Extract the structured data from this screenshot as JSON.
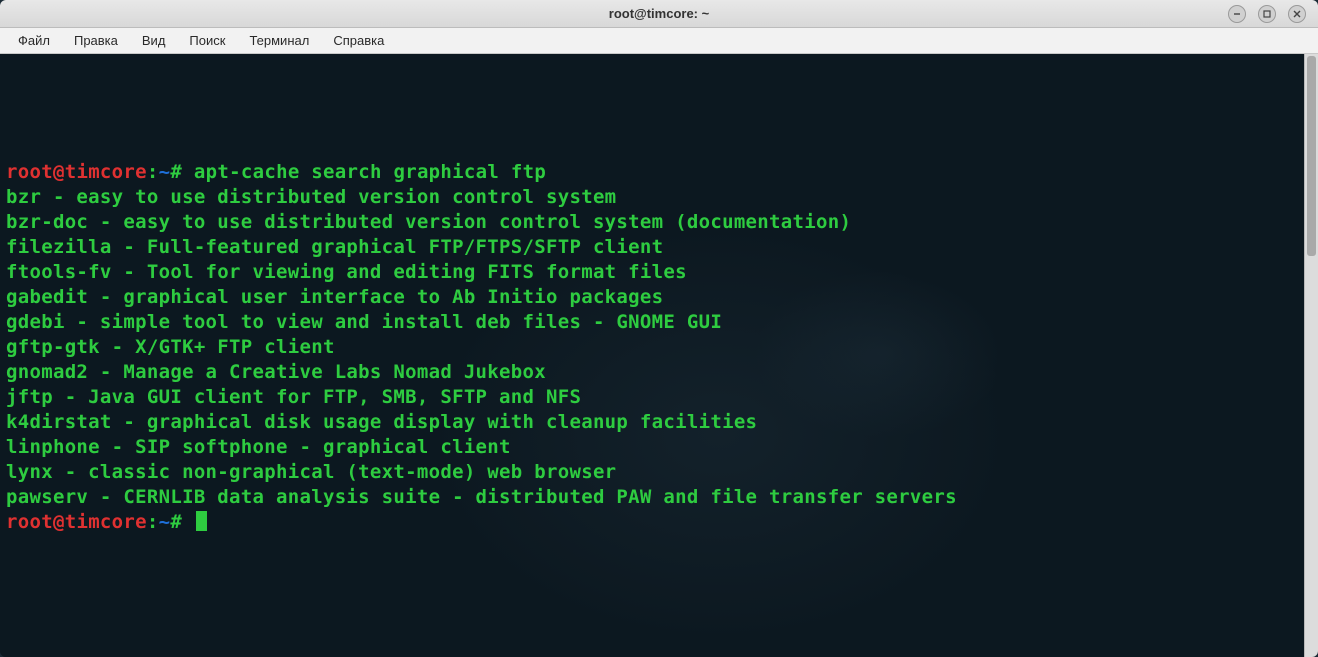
{
  "window": {
    "title": "root@timcore: ~"
  },
  "menubar": {
    "items": [
      "Файл",
      "Правка",
      "Вид",
      "Поиск",
      "Терминал",
      "Справка"
    ]
  },
  "prompt": {
    "user": "root",
    "host": "timcore",
    "at": "@",
    "colon": ":",
    "path": "~",
    "symbol": "#"
  },
  "terminal": {
    "command": "apt-cache search graphical ftp",
    "output_lines": [
      "bzr - easy to use distributed version control system",
      "bzr-doc - easy to use distributed version control system (documentation)",
      "filezilla - Full-featured graphical FTP/FTPS/SFTP client",
      "ftools-fv - Tool for viewing and editing FITS format files",
      "gabedit - graphical user interface to Ab Initio packages",
      "gdebi - simple tool to view and install deb files - GNOME GUI",
      "gftp-gtk - X/GTK+ FTP client",
      "gnomad2 - Manage a Creative Labs Nomad Jukebox",
      "jftp - Java GUI client for FTP, SMB, SFTP and NFS",
      "k4dirstat - graphical disk usage display with cleanup facilities",
      "linphone - SIP softphone - graphical client",
      "lynx - classic non-graphical (text-mode) web browser",
      "pawserv - CERNLIB data analysis suite - distributed PAW and file transfer servers"
    ]
  },
  "colors": {
    "prompt_user": "#e03131",
    "prompt_path": "#1e6fd9",
    "text": "#2ecc40",
    "background": "#0c1820"
  }
}
